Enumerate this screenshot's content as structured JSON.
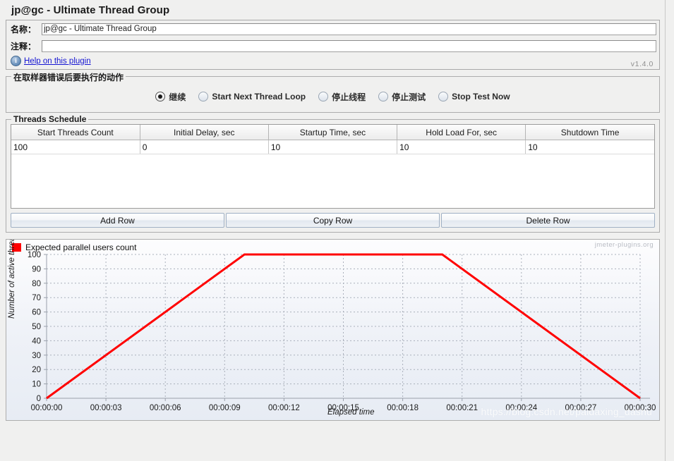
{
  "panel": {
    "title": "jp@gc - Ultimate Thread Group",
    "version": "v1.4.0"
  },
  "form": {
    "name_label": "名称：",
    "name_value": "jp@gc - Ultimate Thread Group",
    "comment_label": "注释：",
    "comment_value": "",
    "comment_placeholder": "",
    "help_icon": "info-icon",
    "help_link": "Help on this plugin"
  },
  "error_action": {
    "group_title": "在取样器错误后要执行的动作",
    "options": [
      {
        "label": "继续",
        "selected": true
      },
      {
        "label": "Start Next Thread Loop",
        "selected": false
      },
      {
        "label": "停止线程",
        "selected": false
      },
      {
        "label": "停止测试",
        "selected": false
      },
      {
        "label": "Stop Test Now",
        "selected": false
      }
    ]
  },
  "schedule": {
    "group_title": "Threads Schedule",
    "columns": [
      "Start Threads Count",
      "Initial Delay, sec",
      "Startup Time, sec",
      "Hold Load For, sec",
      "Shutdown Time"
    ],
    "rows": [
      [
        "100",
        "0",
        "10",
        "10",
        "10"
      ]
    ],
    "buttons": [
      {
        "label": "Add Row",
        "name": "add-row-button"
      },
      {
        "label": "Copy Row",
        "name": "copy-row-button"
      },
      {
        "label": "Delete Row",
        "name": "delete-row-button"
      }
    ]
  },
  "chart_data": {
    "type": "line",
    "title": "",
    "legend": [
      "Expected parallel users count"
    ],
    "legend_position": "top-left",
    "brand": "jmeter-plugins.org",
    "xlabel": "Elapsed time",
    "ylabel": "Number of active threads",
    "grid": true,
    "series_color": "#ff0000",
    "xticks": [
      "00:00:00",
      "00:00:03",
      "00:00:06",
      "00:00:09",
      "00:00:12",
      "00:00:15",
      "00:00:18",
      "00:00:21",
      "00:00:24",
      "00:00:27",
      "00:00:30"
    ],
    "xtick_values": [
      0,
      3,
      6,
      9,
      12,
      15,
      18,
      21,
      24,
      27,
      30
    ],
    "yticks": [
      0,
      10,
      20,
      30,
      40,
      50,
      60,
      70,
      80,
      90,
      100
    ],
    "xlim": [
      0,
      30
    ],
    "ylim": [
      0,
      100
    ],
    "series": [
      {
        "name": "Expected parallel users count",
        "x": [
          0,
          10,
          20,
          30
        ],
        "values": [
          0,
          100,
          100,
          0
        ]
      }
    ],
    "watermark": "https://blog.csdn.net/paidaxing_dashu"
  }
}
